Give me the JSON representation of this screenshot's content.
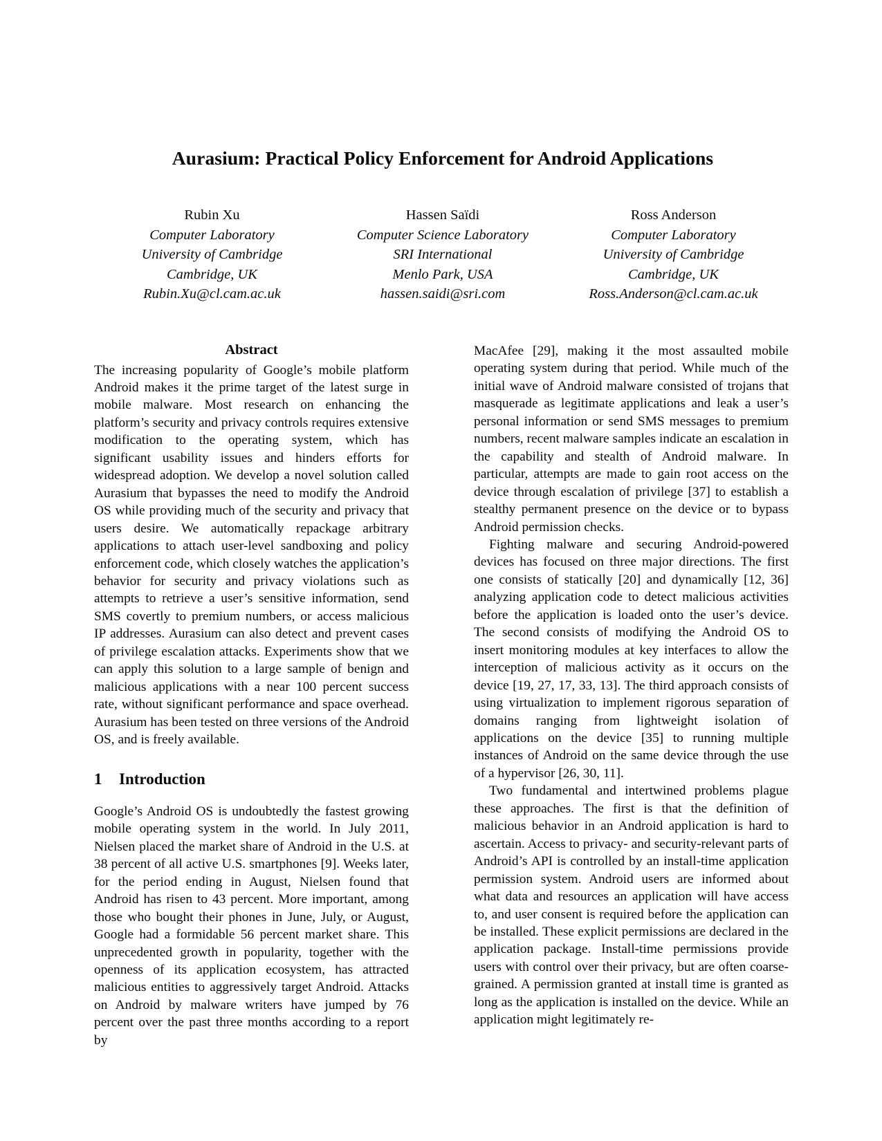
{
  "paper": {
    "title": "Aurasium: Practical Policy Enforcement for Android Applications",
    "authors": [
      {
        "name": "Rubin Xu",
        "affiliation_1": "Computer Laboratory",
        "affiliation_2": "University of Cambridge",
        "location": "Cambridge, UK",
        "email": "Rubin.Xu@cl.cam.ac.uk"
      },
      {
        "name": "Hassen Saïdi",
        "affiliation_1": "Computer Science Laboratory",
        "affiliation_2": "SRI International",
        "location": "Menlo Park, USA",
        "email": "hassen.saidi@sri.com"
      },
      {
        "name": "Ross Anderson",
        "affiliation_1": "Computer Laboratory",
        "affiliation_2": "University of Cambridge",
        "location": "Cambridge, UK",
        "email": "Ross.Anderson@cl.cam.ac.uk"
      }
    ],
    "abstract": {
      "heading": "Abstract",
      "text": "The increasing popularity of Google’s mobile platform Android makes it the prime target of the latest surge in mobile malware. Most research on enhancing the platform’s security and privacy controls requires extensive modification to the operating system, which has significant usability issues and hinders efforts for widespread adoption. We develop a novel solution called Aurasium that bypasses the need to modify the Android OS while providing much of the security and privacy that users desire. We automatically repackage arbitrary applications to attach user-level sandboxing and policy enforcement code, which closely watches the application’s behavior for security and privacy violations such as attempts to retrieve a user’s sensitive information, send SMS covertly to premium numbers, or access malicious IP addresses. Aurasium can also detect and prevent cases of privilege escalation attacks. Experiments show that we can apply this solution to a large sample of benign and malicious applications with a near 100 percent success rate, without significant performance and space overhead. Aurasium has been tested on three versions of the Android OS, and is freely available."
    },
    "sections": [
      {
        "number": "1",
        "title": "Introduction",
        "paragraphs": [
          "Google’s Android OS is undoubtedly the fastest growing mobile operating system in the world. In July 2011, Nielsen placed the market share of Android in the U.S. at 38 percent of all active U.S. smartphones [9]. Weeks later, for the period ending in August, Nielsen found that Android has risen to 43 percent. More important, among those who bought their phones in June, July, or August, Google had a formidable 56 percent market share. This unprecedented growth in popularity, together with the openness of its application ecosystem, has attracted malicious entities to aggressively target Android. Attacks on Android by malware writers have jumped by 76 percent over the past three months according to a report by MacAfee [29], making it the most assaulted mobile operating system during that period. While much of the initial wave of Android malware consisted of trojans that masquerade as legitimate applications and leak a user’s personal information or send SMS messages to premium numbers, recent malware samples indicate an escalation in the capability and stealth of Android malware. In particular, attempts are made to gain root access on the device through escalation of privilege [37] to establish a stealthy permanent presence on the device or to bypass Android permission checks.",
          "Fighting malware and securing Android-powered devices has focused on three major directions. The first one consists of statically [20] and dynamically [12, 36] analyzing application code to detect malicious activities before the application is loaded onto the user’s device. The second consists of modifying the Android OS to insert monitoring modules at key interfaces to allow the interception of malicious activity as it occurs on the device [19, 27, 17, 33, 13]. The third approach consists of using virtualization to implement rigorous separation of domains ranging from lightweight isolation of applications on the device [35] to running multiple instances of Android on the same device through the use of a hypervisor [26, 30, 11].",
          "Two fundamental and intertwined problems plague these approaches. The first is that the definition of malicious behavior in an Android application is hard to ascertain. Access to privacy- and security-relevant parts of Android’s API is controlled by an install-time application permission system. Android users are informed about what data and resources an application will have access to, and user consent is required before the application can be installed. These explicit permissions are declared in the application package. Install-time permissions provide users with control over their privacy, but are often coarse-grained. A permission granted at install time is granted as long as the application is installed on the device. While an application might legitimately re-"
        ]
      }
    ],
    "columns": {
      "left_text": "Google’s Android OS is undoubtedly the fastest growing mobile operating system in the world. In July 2011, Nielsen placed the market share of Android in the U.S. at 38 percent of all active U.S. smartphones [9]. Weeks later, for the period ending in August, Nielsen found that Android has risen to 43 percent. More important, among those who bought their phones in June, July, or August, Google had a formidable 56 percent market share. This unprecedented growth in popularity, together with the openness of its application ecosystem, has attracted malicious entities to aggressively target Android. Attacks on Android by malware writers have jumped by 76 percent over the past three months according to a report by",
      "right_par_1": "MacAfee [29], making it the most assaulted mobile operating system during that period. While much of the initial wave of Android malware consisted of trojans that masquerade as legitimate applications and leak a user’s personal information or send SMS messages to premium numbers, recent malware samples indicate an escalation in the capability and stealth of Android malware. In particular, attempts are made to gain root access on the device through escalation of privilege [37] to establish a stealthy permanent presence on the device or to bypass Android permission checks.",
      "right_par_2": "Fighting malware and securing Android-powered devices has focused on three major directions. The first one consists of statically [20] and dynamically [12, 36] analyzing application code to detect malicious activities before the application is loaded onto the user’s device. The second consists of modifying the Android OS to insert monitoring modules at key interfaces to allow the interception of malicious activity as it occurs on the device [19, 27, 17, 33, 13]. The third approach consists of using virtualization to implement rigorous separation of domains ranging from lightweight isolation of applications on the device [35] to running multiple instances of Android on the same device through the use of a hypervisor [26, 30, 11].",
      "right_par_3": "Two fundamental and intertwined problems plague these approaches. The first is that the definition of malicious behavior in an Android application is hard to ascertain. Access to privacy- and security-relevant parts of Android’s API is controlled by an install-time application permission system. Android users are informed about what data and resources an application will have access to, and user consent is required before the application can be installed. These explicit permissions are declared in the application package. Install-time permissions provide users with control over their privacy, but are often coarse-grained. A permission granted at install time is granted as long as the application is installed on the device. While an application might legitimately re-"
    }
  }
}
